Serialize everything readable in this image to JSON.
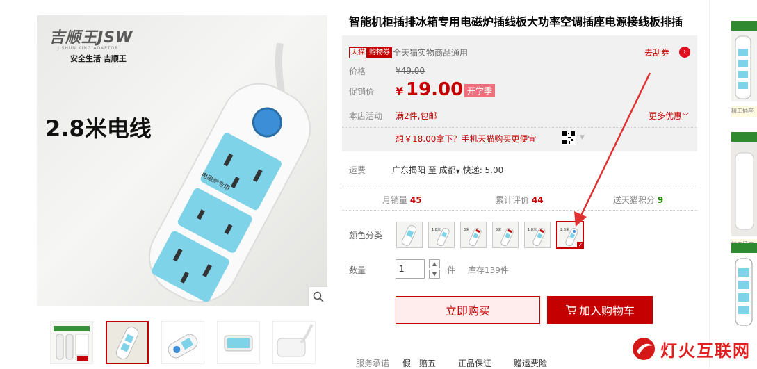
{
  "gallery": {
    "brand_logo": "吉顺王JSW",
    "brand_sub": "JISHUN KING ADAPTOR",
    "brand_slogan": "安全生活 吉顺王",
    "image_caption": "2.8米电线",
    "socket_label": "电磁炉专用"
  },
  "product": {
    "title": "智能机柜插排冰箱专用电磁炉插线板大功率空调插座电源接线板排插"
  },
  "coupon": {
    "badge_tmall": "天猫",
    "badge_coupon": "购物券",
    "text": "全天猫实物商品通用",
    "link": "去刮券"
  },
  "price": {
    "label": "价格",
    "original": "¥49.00",
    "promo_label": "促销价",
    "currency": "¥",
    "promo_value": "19.00",
    "promo_tag": "开学季"
  },
  "store_activity": {
    "label": "本店活动",
    "text": "满2件,包邮",
    "more": "更多优惠"
  },
  "mobile_promo": {
    "text": "想￥18.00拿下？手机天猫购买更便宜"
  },
  "shipping": {
    "label": "运费",
    "from": "广东揭阳",
    "to_word": "至",
    "to": "成都",
    "express": "快递: 5.00"
  },
  "stats": [
    {
      "label": "月销量",
      "value": "45"
    },
    {
      "label": "累计评价",
      "value": "44"
    },
    {
      "label": "送天猫积分",
      "value": "9"
    }
  ],
  "color": {
    "label": "颜色分类",
    "selected_index": 5
  },
  "quantity": {
    "label": "数量",
    "value": "1",
    "unit": "件",
    "stock": "库存139件"
  },
  "actions": {
    "buy_now": "立即购买",
    "add_cart": "加入购物车"
  },
  "service": {
    "label": "服务承诺",
    "items": [
      "假一赔五",
      "正品保证",
      "赠运费险"
    ]
  },
  "recommend": {
    "label": "精工插座"
  },
  "watermark": {
    "text": "灯火互联网"
  },
  "colors": {
    "accent": "#c40000",
    "price_bg": "#f1f1f1",
    "arrow": "#e03030"
  }
}
